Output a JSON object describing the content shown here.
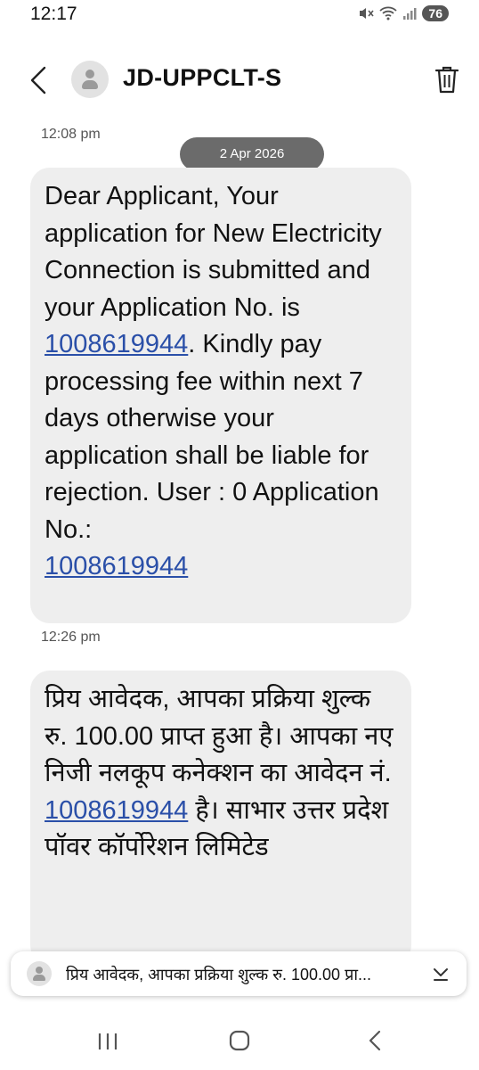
{
  "status": {
    "time": "12:17",
    "battery": "76"
  },
  "header": {
    "sender": "JD-UPPCLT-S"
  },
  "thread": {
    "time_top": "12:08 pm",
    "date_separator": "2 Apr 2026",
    "message1": {
      "text_before_link": "Dear Applicant, Your application for New Electricity Connection is submitted and your Application No. is ",
      "link1": "1008619944",
      "text_middle": ". Kindly pay processing fee within next 7 days otherwise your application shall be liable for rejection. User : 0 Application No.:",
      "link2": "1008619944"
    },
    "time_mid": "12:26 pm",
    "message2": {
      "text_before_link": "प्रिय आवेदक, आपका प्रक्रिया शुल्क रु. 100.00 प्राप्त हुआ है। आपका नए निजी नलकूप कनेक्शन का आवेदन नं. ",
      "link": "1008619944",
      "text_after_link": " है। साभार उत्तर प्रदेश पॉवर कॉर्पोरेशन लिमिटेड"
    }
  },
  "preview": {
    "text": "प्रिय आवेदक, आपका प्रक्रिया शुल्क रु. 100.00 प्रा..."
  },
  "icons": {
    "back": "arrow-left-icon",
    "avatar": "person-icon",
    "delete": "trash-icon",
    "expand": "chevron-down-icon",
    "nav_recents": "recents-icon",
    "nav_home": "home-icon",
    "nav_back": "nav-back-icon"
  }
}
